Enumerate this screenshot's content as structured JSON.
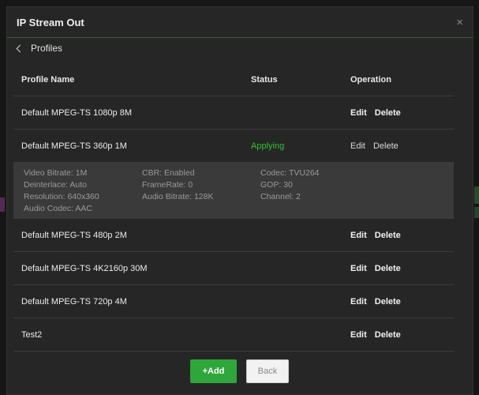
{
  "dialog": {
    "title": "IP Stream Out",
    "close_glyph": "×",
    "back_label": "Profiles"
  },
  "table": {
    "headers": {
      "name": "Profile Name",
      "status": "Status",
      "operation": "Operation"
    },
    "rows": [
      {
        "name": "Default MPEG-TS 1080p 8M",
        "status": "",
        "edit": "Edit",
        "delete": "Delete"
      },
      {
        "name": "Default MPEG-TS 360p 1M",
        "status": "Applying",
        "edit": "Edit",
        "delete": "Delete"
      },
      {
        "name": "Default MPEG-TS 480p 2M",
        "status": "",
        "edit": "Edit",
        "delete": "Delete"
      },
      {
        "name": "Default MPEG-TS 4K2160p 30M",
        "status": "",
        "edit": "Edit",
        "delete": "Delete"
      },
      {
        "name": "Default MPEG-TS 720p 4M",
        "status": "",
        "edit": "Edit",
        "delete": "Delete"
      },
      {
        "name": "Test2",
        "status": "",
        "edit": "Edit",
        "delete": "Delete"
      }
    ],
    "detail": {
      "video_bitrate": "Video Bitrate:  1M",
      "cbr": "CBR:  Enabled",
      "codec": "Codec:  TVU264",
      "deinterlace": "Deinterlace:  Auto",
      "framerate": "FrameRate:  0",
      "gop": "GOP:  30",
      "resolution": "Resolution:  640x360",
      "audio_bitrate": "Audio Bitrate:  128K",
      "channel": "Channel:  2",
      "audio_codec": "Audio Codec:  AAC"
    }
  },
  "footer": {
    "add_label": "+Add",
    "back_label": "Back"
  },
  "colors": {
    "accent_green": "#2fa63c",
    "status_applying": "#33c133",
    "dialog_bg": "#262626"
  }
}
